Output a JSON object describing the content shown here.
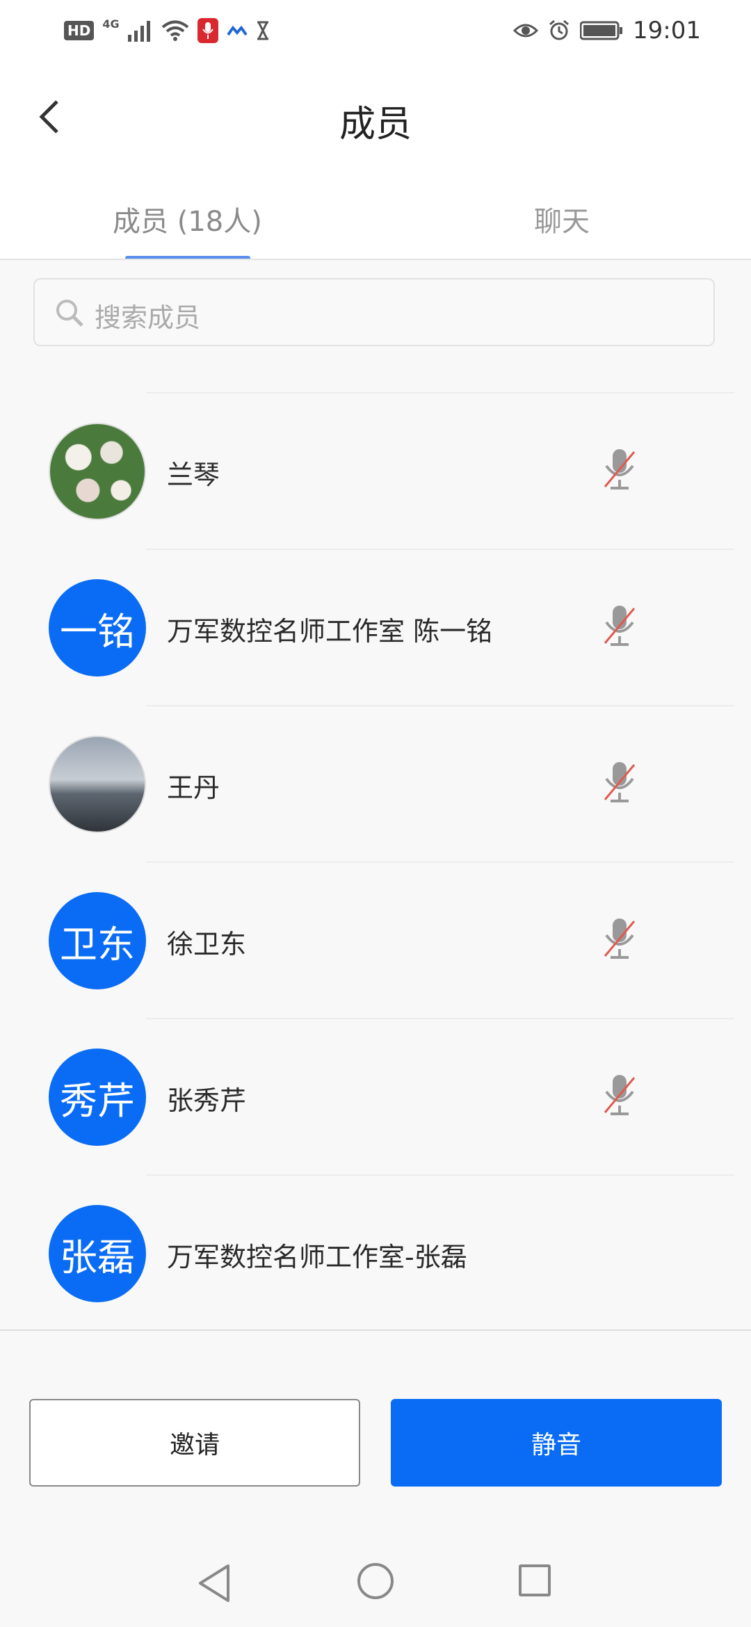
{
  "status_bar": {
    "hd": "HD",
    "network": "4G",
    "time": "19:01"
  },
  "header": {
    "title": "成员",
    "tabs": [
      {
        "label": "成员 (18人)",
        "active": true
      },
      {
        "label": "聊天",
        "active": false
      }
    ]
  },
  "search": {
    "placeholder": "搜索成员"
  },
  "members": [
    {
      "avatar_type": "photo",
      "avatar_text": "",
      "name": "兰琴",
      "muted": true
    },
    {
      "avatar_type": "text",
      "avatar_text": "一铭",
      "name": "万军数控名师工作室 陈一铭",
      "muted": true
    },
    {
      "avatar_type": "photo",
      "avatar_text": "",
      "name": "王丹",
      "muted": true
    },
    {
      "avatar_type": "text",
      "avatar_text": "卫东",
      "name": "徐卫东",
      "muted": true
    },
    {
      "avatar_type": "text",
      "avatar_text": "秀芹",
      "name": "张秀芹",
      "muted": true
    },
    {
      "avatar_type": "text",
      "avatar_text": "张磊",
      "name": "万军数控名师工作室-张磊",
      "muted": false
    }
  ],
  "buttons": {
    "invite": "邀请",
    "mute": "静音"
  },
  "colors": {
    "accent": "#0a6cf5",
    "tab_indicator": "#5a8dee",
    "muted_slash": "#e05a4f"
  }
}
